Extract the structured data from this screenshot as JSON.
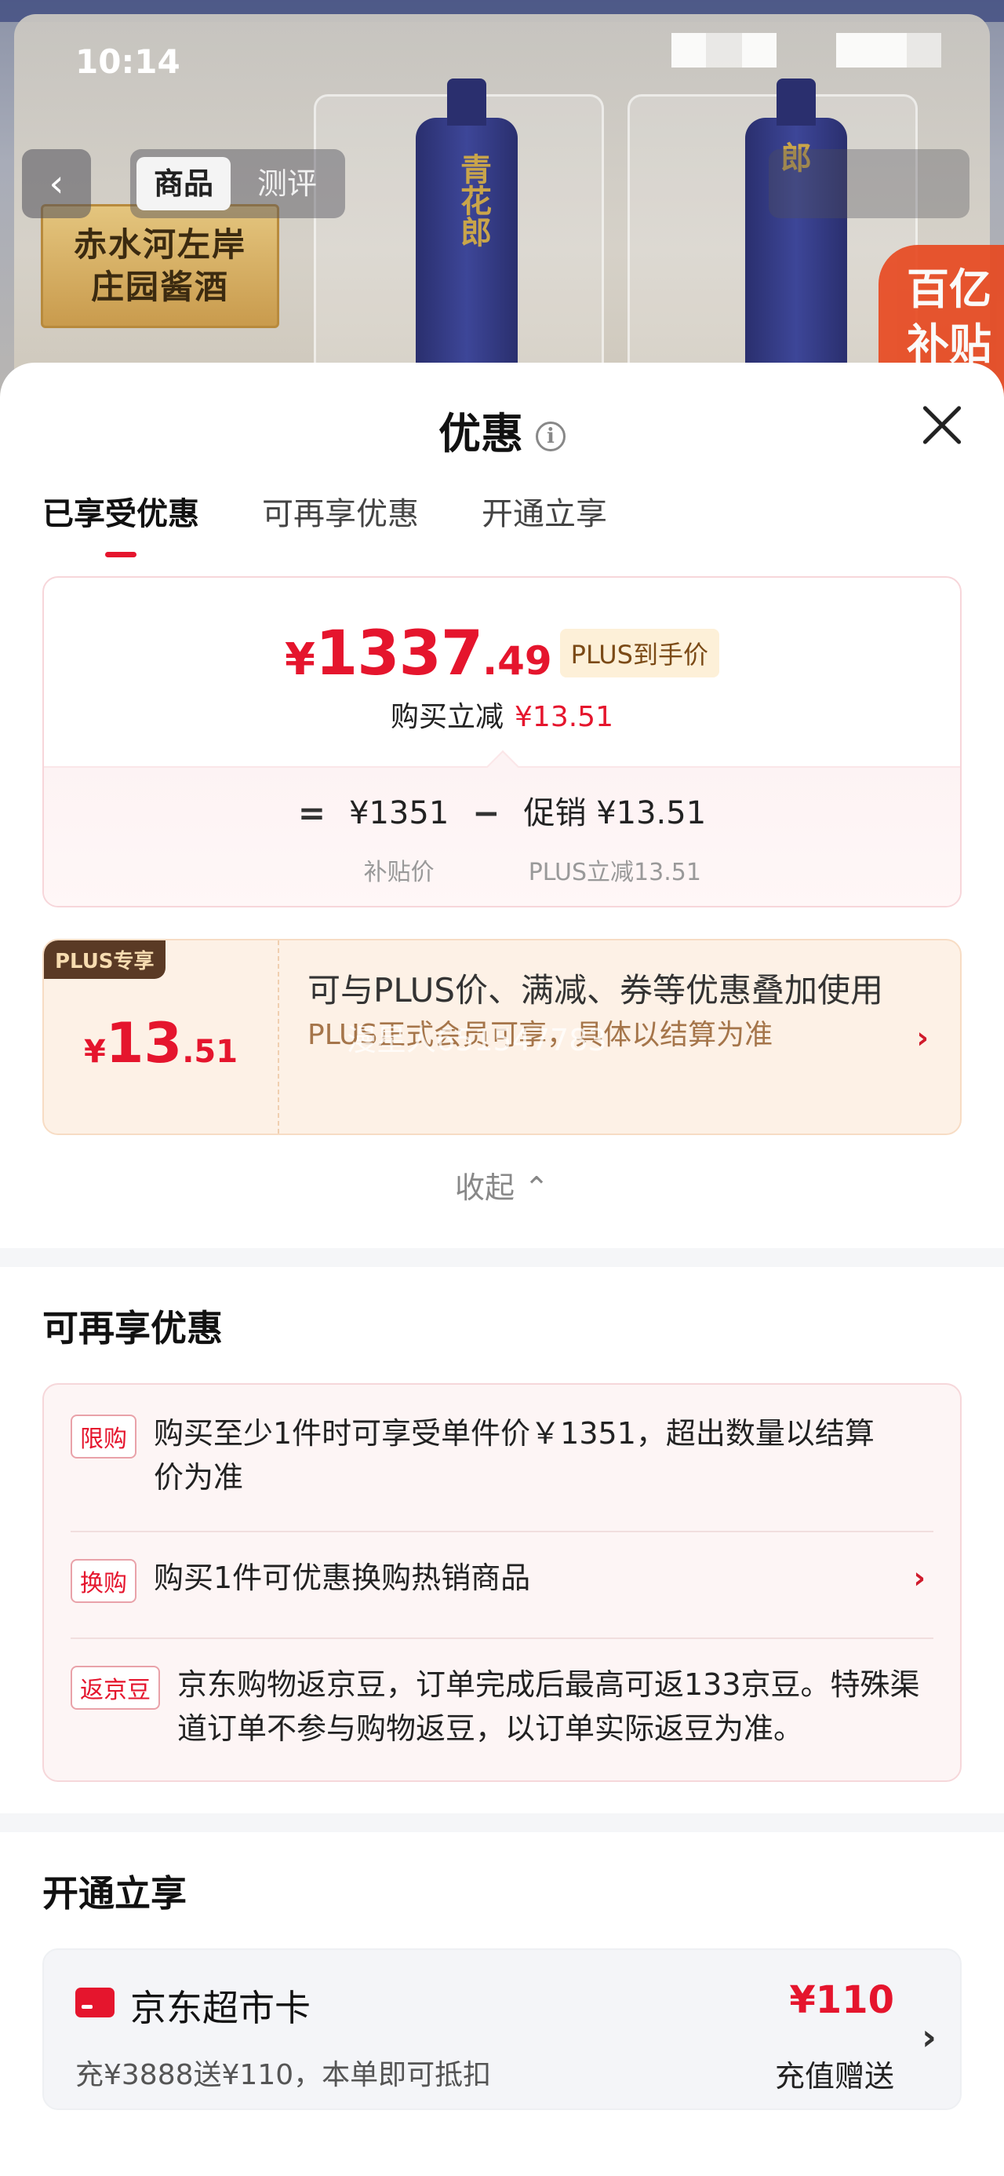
{
  "status": {
    "time": "10:14"
  },
  "nav": {
    "back_icon": "chevron-left-icon",
    "tabs": [
      "商品",
      "测评"
    ]
  },
  "hero": {
    "badge_line1": "赤水河左岸",
    "badge_line2": "庄园酱酒",
    "bottle1_text": "青花郎",
    "bottle2_text": "郎",
    "subsidy_line1": "百亿",
    "subsidy_line2": "补贴"
  },
  "sheet": {
    "title": "优惠",
    "info_icon": "info-icon",
    "close_icon": "close-icon",
    "tabs": [
      "已享受优惠",
      "可再享优惠",
      "开通立享"
    ]
  },
  "price": {
    "yen": "¥",
    "int": "1337",
    "dec": ".49",
    "plus_tag": "PLUS到手价",
    "sub_label": "购买立减",
    "sub_amount": "¥13.51",
    "eq": "=",
    "base_value": "¥1351",
    "base_caption": "补贴价",
    "minus": "−",
    "promo_value": "促销 ¥13.51",
    "promo_caption": "PLUS立减13.51"
  },
  "plus": {
    "badge": "PLUS专享",
    "yen": "¥",
    "int": "13",
    "dec": ".51",
    "line1": "可与PLUS价、满减、券等优惠叠加使用",
    "line2": "PLUS正式会员可享，具体以结算为准",
    "watermark": "漫星人651547783",
    "chevron": "›"
  },
  "collapse_label": "收起 ⌃",
  "more": {
    "title": "可再享优惠",
    "items": [
      {
        "tag": "限购",
        "text": "购买至少1件时可享受单件价￥1351，超出数量以结算价为准"
      },
      {
        "tag": "换购",
        "text": "购买1件可优惠换购热销商品",
        "chevron": "›"
      },
      {
        "tag": "返京豆",
        "text": "京东购物返京豆，订单完成后最高可返133京豆。特殊渠道订单不参与购物返豆，以订单实际返豆为准。"
      }
    ]
  },
  "open": {
    "title": "开通立享",
    "card_icon": "card-icon",
    "card_name": "京东超市卡",
    "card_desc": "充¥3888送¥110，本单即可抵扣",
    "card_amount": "¥110",
    "card_label": "充值赠送",
    "chevron": "›"
  },
  "colors": {
    "accent": "#e5152d",
    "plus_bg": "#fdf1e6"
  }
}
